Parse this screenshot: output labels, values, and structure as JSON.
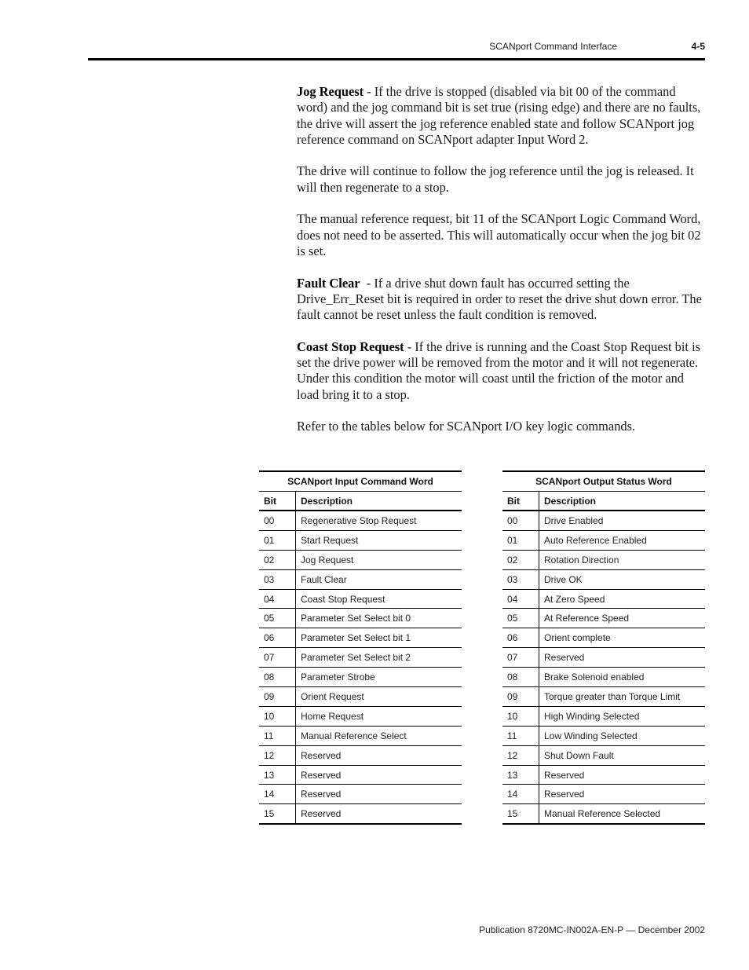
{
  "header": {
    "section_title": "SCANport Command Interface",
    "page_number": "4-5"
  },
  "paragraphs": [
    {
      "lead": "Jog Request",
      "text": " - If the drive is stopped (disabled via bit 00 of the command word) and the jog command bit is set true (rising edge) and there are no faults, the drive will assert the jog reference enabled state and follow SCANport jog reference command on SCANport adapter Input Word 2."
    },
    {
      "lead": "",
      "text": "The drive will continue to follow the jog reference until the jog is released. It will then regenerate to a stop."
    },
    {
      "lead": "",
      "text": "The manual reference request, bit 11 of the SCANport Logic Command Word, does not need to be asserted. This will automatically occur when the jog bit 02 is set."
    },
    {
      "lead": "Fault Clear",
      "text": "  - If a drive shut down fault has occurred setting the Drive_Err_Reset bit is required in order to reset the drive shut down error. The fault cannot be reset unless the fault condition is removed."
    },
    {
      "lead": "Coast Stop Request",
      "text": " - If the drive is running and the Coast Stop Request bit is set the drive power will be removed from the motor and it will not regenerate. Under this condition the motor will coast until the friction of the motor and load bring it to a stop."
    },
    {
      "lead": "",
      "text": "Refer to the tables below for SCANport I/O key logic commands."
    }
  ],
  "tables": {
    "input": {
      "title": "SCANport Input Command Word",
      "col_bit": "Bit",
      "col_desc": "Description",
      "rows": [
        {
          "bit": "00",
          "desc": "Regenerative Stop Request"
        },
        {
          "bit": "01",
          "desc": "Start Request"
        },
        {
          "bit": "02",
          "desc": "Jog Request"
        },
        {
          "bit": "03",
          "desc": "Fault Clear"
        },
        {
          "bit": "04",
          "desc": "Coast Stop Request"
        },
        {
          "bit": "05",
          "desc": "Parameter Set Select bit 0"
        },
        {
          "bit": "06",
          "desc": "Parameter Set Select bit 1"
        },
        {
          "bit": "07",
          "desc": "Parameter Set Select bit 2"
        },
        {
          "bit": "08",
          "desc": "Parameter Strobe"
        },
        {
          "bit": "09",
          "desc": "Orient Request"
        },
        {
          "bit": "10",
          "desc": "Home Request"
        },
        {
          "bit": "11",
          "desc": "Manual Reference Select"
        },
        {
          "bit": "12",
          "desc": "Reserved"
        },
        {
          "bit": "13",
          "desc": "Reserved"
        },
        {
          "bit": "14",
          "desc": "Reserved"
        },
        {
          "bit": "15",
          "desc": "Reserved"
        }
      ]
    },
    "output": {
      "title": "SCANport Output Status Word",
      "col_bit": "Bit",
      "col_desc": "Description",
      "rows": [
        {
          "bit": "00",
          "desc": "Drive Enabled"
        },
        {
          "bit": "01",
          "desc": "Auto Reference Enabled"
        },
        {
          "bit": "02",
          "desc": "Rotation Direction"
        },
        {
          "bit": "03",
          "desc": "Drive OK"
        },
        {
          "bit": "04",
          "desc": "At Zero Speed"
        },
        {
          "bit": "05",
          "desc": "At Reference Speed"
        },
        {
          "bit": "06",
          "desc": "Orient complete"
        },
        {
          "bit": "07",
          "desc": "Reserved"
        },
        {
          "bit": "08",
          "desc": "Brake Solenoid enabled"
        },
        {
          "bit": "09",
          "desc": "Torque greater than Torque Limit"
        },
        {
          "bit": "10",
          "desc": "High Winding Selected"
        },
        {
          "bit": "11",
          "desc": "Low Winding Selected"
        },
        {
          "bit": "12",
          "desc": "Shut Down Fault"
        },
        {
          "bit": "13",
          "desc": "Reserved"
        },
        {
          "bit": "14",
          "desc": "Reserved"
        },
        {
          "bit": "15",
          "desc": "Manual Reference Selected"
        }
      ]
    }
  },
  "footer": {
    "publication": "Publication 8720MC-IN002A-EN-P — December 2002"
  }
}
